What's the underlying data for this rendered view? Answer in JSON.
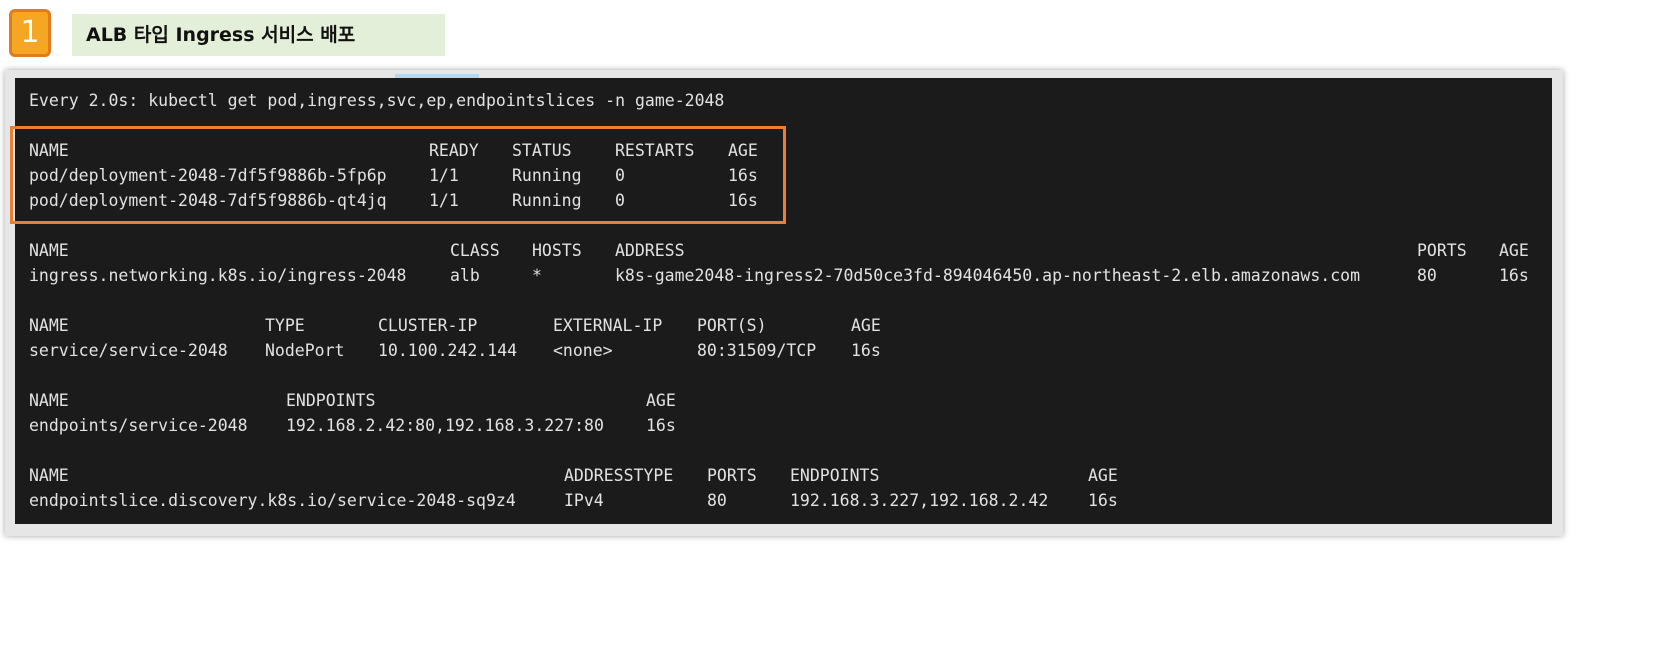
{
  "step": {
    "number": "1",
    "title": "ALB 타입 Ingress 서비스 배포"
  },
  "terminal": {
    "command": "Every 2.0s: kubectl get pod,ingress,svc,ep,endpointslices -n game-2048",
    "pods": {
      "headers": [
        "NAME",
        "READY",
        "STATUS",
        "RESTARTS",
        "AGE"
      ],
      "rows": [
        [
          "pod/deployment-2048-7df5f9886b-5fp6p",
          "1/1",
          "Running",
          "0",
          "16s"
        ],
        [
          "pod/deployment-2048-7df5f9886b-qt4jq",
          "1/1",
          "Running",
          "0",
          "16s"
        ]
      ]
    },
    "ingress": {
      "headers": [
        "NAME",
        "CLASS",
        "HOSTS",
        "ADDRESS",
        "PORTS",
        "AGE"
      ],
      "rows": [
        [
          "ingress.networking.k8s.io/ingress-2048",
          "alb",
          "*",
          "k8s-game2048-ingress2-70d50ce3fd-894046450.ap-northeast-2.elb.amazonaws.com",
          "80",
          "16s"
        ]
      ]
    },
    "services": {
      "headers": [
        "NAME",
        "TYPE",
        "CLUSTER-IP",
        "EXTERNAL-IP",
        "PORT(S)",
        "AGE"
      ],
      "rows": [
        [
          "service/service-2048",
          "NodePort",
          "10.100.242.144",
          "<none>",
          "80:31509/TCP",
          "16s"
        ]
      ]
    },
    "endpoints": {
      "headers": [
        "NAME",
        "ENDPOINTS",
        "AGE"
      ],
      "rows": [
        [
          "endpoints/service-2048",
          "192.168.2.42:80,192.168.3.227:80",
          "16s"
        ]
      ]
    },
    "endpointslices": {
      "headers": [
        "NAME",
        "ADDRESSTYPE",
        "PORTS",
        "ENDPOINTS",
        "AGE"
      ],
      "rows": [
        [
          "endpointslice.discovery.k8s.io/service-2048-sq9z4",
          "IPv4",
          "80",
          "192.168.3.227,192.168.2.42",
          "16s"
        ]
      ]
    }
  },
  "colors": {
    "terminal_bg": "#1b1b1b",
    "terminal_text": "#e2e2e2",
    "highlight": "#ed7d31",
    "badge": "#f5a623",
    "title_bg": "#e3efd8"
  }
}
